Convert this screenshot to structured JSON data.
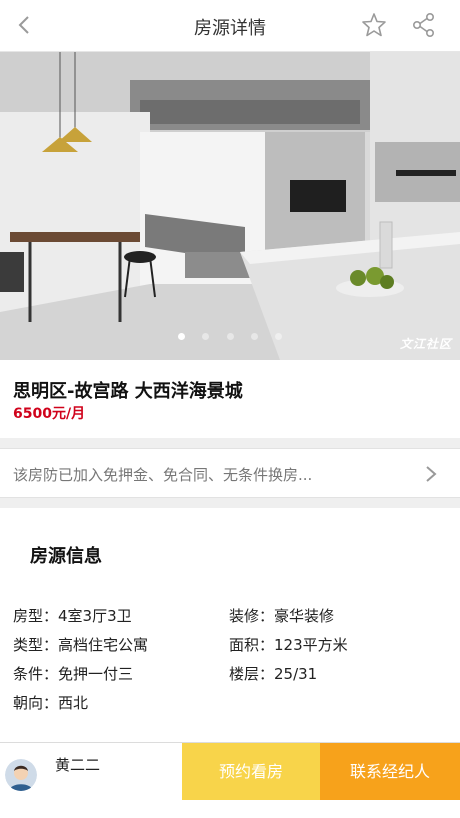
{
  "nav": {
    "title": "房源详情",
    "back_icon": "chevron-left-icon",
    "favorite_icon": "star-outline-icon",
    "share_icon": "share-icon"
  },
  "gallery": {
    "image": "living-room-photo",
    "watermark": "文江社区",
    "slide_count": 5,
    "active_slide": 1
  },
  "listing": {
    "title": "思明区-故宫路 大西洋海景城",
    "price": "6500元/月"
  },
  "promo": {
    "text": "该房防已加入免押金、免合同、无条件换房...",
    "icon": "chevron-right-icon"
  },
  "details": {
    "heading": "房源信息",
    "layout": "房型：4室3厅3卫",
    "decoration": "装修：豪华装修",
    "type": "类型：高档住宅公寓",
    "area": "面积：123平方米",
    "terms": "条件：免押一付三",
    "floor": "楼层：25/31",
    "orientation": "朝向：西北"
  },
  "agent": {
    "name": "黄二二",
    "avatar_icon": "avatar-icon"
  },
  "actions": {
    "book_label": "预约看房",
    "contact_label": "联系经纪人"
  },
  "colors": {
    "price": "#d0021b",
    "book_button": "#f8d44a",
    "contact_button": "#f7a21b"
  }
}
